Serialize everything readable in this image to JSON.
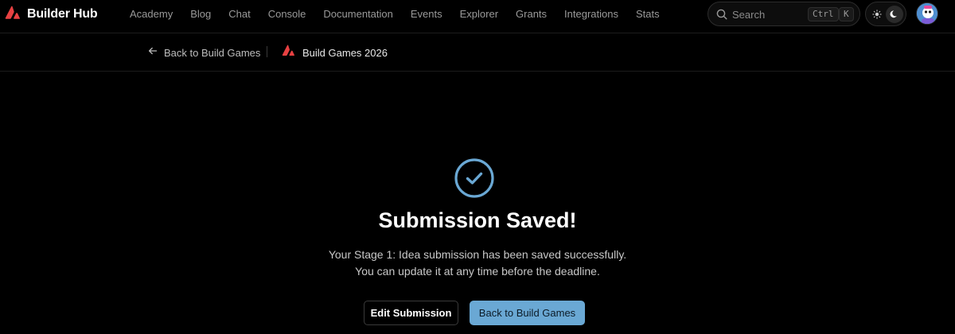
{
  "header": {
    "brand": "Builder Hub",
    "nav": [
      "Academy",
      "Blog",
      "Chat",
      "Console",
      "Documentation",
      "Events",
      "Explorer",
      "Grants",
      "Integrations",
      "Stats"
    ],
    "search": {
      "label": "Search",
      "shortcut_mod": "Ctrl",
      "shortcut_key": "K"
    },
    "theme_icons": [
      "sun-icon",
      "moon-icon"
    ]
  },
  "subheader": {
    "back_label": "Back to Build Games",
    "event_title": "Build Games 2026"
  },
  "main": {
    "title": "Submission Saved!",
    "message_line1": "Your Stage 1: Idea submission has been saved successfully.",
    "message_line2": "You can update it at any time before the deadline.",
    "edit_button": "Edit Submission",
    "back_button": "Back to Build Games"
  },
  "colors": {
    "brand_red": "#e84142",
    "accent_blue": "#6aa8d4",
    "background": "#000000"
  }
}
